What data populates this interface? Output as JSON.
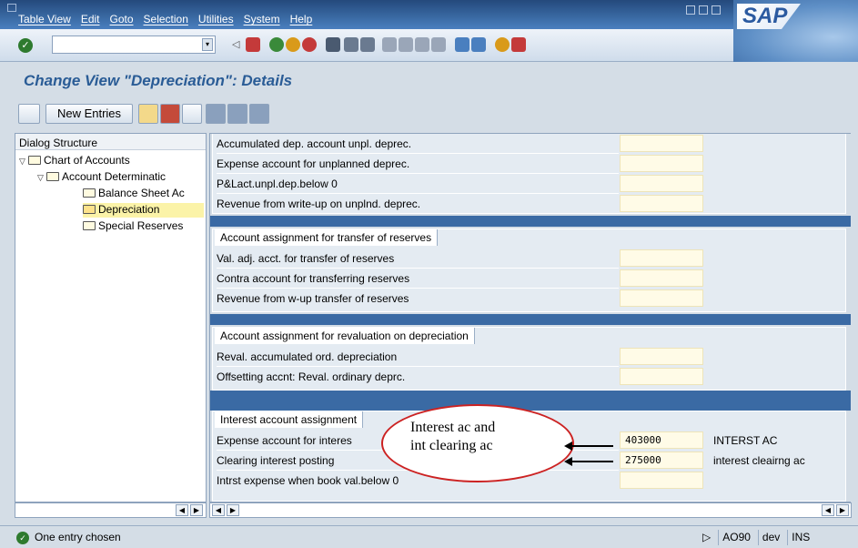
{
  "menubar": {
    "items": [
      "Table View",
      "Edit",
      "Goto",
      "Selection",
      "Utilities",
      "System",
      "Help"
    ]
  },
  "brand": {
    "logo_text": "SAP"
  },
  "toolbar": {
    "command_field_value": ""
  },
  "title": {
    "text": "Change View \"Depreciation\": Details"
  },
  "app_toolbar": {
    "new_entries_label": "New Entries"
  },
  "dialog_structure": {
    "header": "Dialog Structure",
    "items": [
      {
        "label": "Chart of Accounts",
        "expanded": true
      },
      {
        "label": "Account Determinatic",
        "expanded": true
      },
      {
        "label": "Balance Sheet Ac"
      },
      {
        "label": "Depreciation",
        "selected": true
      },
      {
        "label": "Special Reserves"
      }
    ]
  },
  "groups": [
    {
      "header": "",
      "rows": [
        {
          "label": "Accumulated dep. account unpl. deprec.",
          "value": "",
          "desc": ""
        },
        {
          "label": "Expense account for unplanned deprec.",
          "value": "",
          "desc": ""
        },
        {
          "label": "P&Lact.unpl.dep.below 0",
          "value": "",
          "desc": ""
        },
        {
          "label": "Revenue from write-up on unplnd. deprec.",
          "value": "",
          "desc": ""
        }
      ]
    },
    {
      "header": "Account assignment for transfer of reserves",
      "rows": [
        {
          "label": "Val. adj. acct. for transfer of reserves",
          "value": "",
          "desc": ""
        },
        {
          "label": "Contra account for transferring reserves",
          "value": "",
          "desc": ""
        },
        {
          "label": "Revenue from w-up transfer of reserves",
          "value": "",
          "desc": ""
        }
      ]
    },
    {
      "header": "Account assignment for revaluation on depreciation",
      "rows": [
        {
          "label": "Reval. accumulated ord. depreciation",
          "value": "",
          "desc": ""
        },
        {
          "label": "Offsetting accnt: Reval. ordinary deprc.",
          "value": "",
          "desc": ""
        }
      ]
    },
    {
      "header": "Interest account assignment",
      "rows": [
        {
          "label": "Expense account for interes",
          "value": "403000",
          "desc": "INTERST AC"
        },
        {
          "label": "Clearing interest posting",
          "value": "275000",
          "desc": "interest cleairng ac"
        },
        {
          "label": "Intrst expense when book val.below 0",
          "value": "",
          "desc": ""
        }
      ]
    }
  ],
  "annotation": {
    "line1": "Interest ac and",
    "line2": "int clearing ac"
  },
  "status": {
    "message": "One entry chosen",
    "transaction": "AO90",
    "client": "dev",
    "mode": "INS"
  }
}
